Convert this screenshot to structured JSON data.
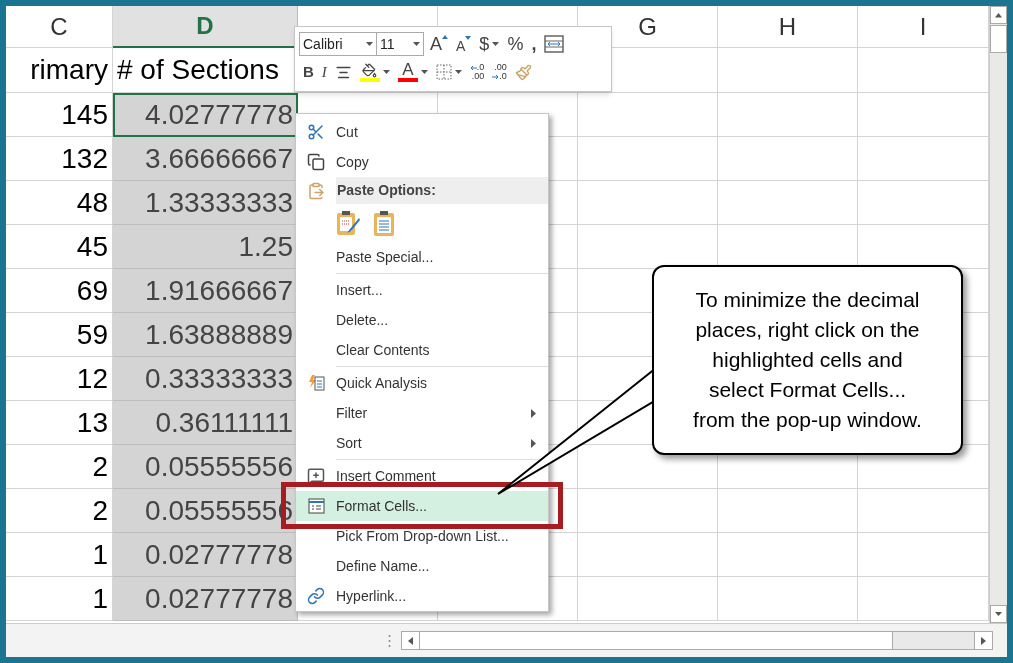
{
  "columns": [
    {
      "label": "C",
      "selected": false
    },
    {
      "label": "D",
      "selected": true
    },
    {
      "selected": false
    },
    {
      "selected": false
    },
    {
      "label": "G",
      "selected": false
    },
    {
      "label": "H",
      "selected": false
    },
    {
      "label": "I",
      "selected": false
    }
  ],
  "header_row": [
    "rimary",
    "# of Sections"
  ],
  "rows": [
    {
      "cells": [
        "145",
        "4.02777778"
      ],
      "active": true
    },
    {
      "cells": [
        "132",
        "3.66666667"
      ],
      "active": false
    },
    {
      "cells": [
        "48",
        "1.33333333"
      ],
      "active": false
    },
    {
      "cells": [
        "45",
        "1.25"
      ],
      "active": false
    },
    {
      "cells": [
        "69",
        "1.91666667"
      ],
      "active": false
    },
    {
      "cells": [
        "59",
        "1.63888889"
      ],
      "active": false
    },
    {
      "cells": [
        "12",
        "0.33333333"
      ],
      "active": false
    },
    {
      "cells": [
        "13",
        "0.36111111"
      ],
      "active": false
    },
    {
      "cells": [
        "2",
        "0.05555556"
      ],
      "active": false
    },
    {
      "cells": [
        "2",
        "0.05555556"
      ],
      "active": false
    },
    {
      "cells": [
        "1",
        "0.02777778"
      ],
      "active": false
    },
    {
      "cells": [
        "1",
        "0.02777778"
      ],
      "active": false
    }
  ],
  "mini_toolbar": {
    "font": "Calibri",
    "size": "11",
    "row1": [
      {
        "kind": "grow",
        "glyph": "A",
        "dropdown": false
      },
      {
        "kind": "shrink",
        "glyph": "A",
        "dropdown": false
      },
      {
        "kind": "currency",
        "glyph": "$",
        "dropdown": true
      },
      {
        "kind": "percent",
        "glyph": "%",
        "dropdown": false
      },
      {
        "kind": "comma",
        "glyph": ",",
        "dropdown": false
      },
      {
        "kind": "wrap",
        "dropdown": false
      }
    ],
    "row2": [
      {
        "kind": "bold",
        "glyph": "B",
        "dropdown": false
      },
      {
        "kind": "italic",
        "glyph": "I",
        "dropdown": false
      },
      {
        "kind": "center",
        "dropdown": false
      },
      {
        "kind": "fill",
        "color": "#ffff00",
        "dropdown": true
      },
      {
        "kind": "font-color",
        "glyph": "A",
        "color": "#ff0000",
        "dropdown": true
      },
      {
        "kind": "borders",
        "dropdown": true
      },
      {
        "kind": "increase-decimal",
        "glyph_top": ".0",
        "glyph_bottom": ".00",
        "dropdown": false
      },
      {
        "kind": "decrease-decimal",
        "glyph_top": ".00",
        "glyph_bottom": ".0",
        "dropdown": false
      },
      {
        "kind": "format-painter",
        "dropdown": false
      }
    ]
  },
  "context_menu": [
    {
      "kind": "cut",
      "label": "Cut",
      "selected": false,
      "submenu": false
    },
    {
      "kind": "copy",
      "label": "Copy",
      "selected": false,
      "submenu": false
    },
    {
      "kind": "header",
      "label": "Paste Options:"
    },
    {
      "kind": "paste-buttons"
    },
    {
      "kind": "plain",
      "label": "Paste Special...",
      "selected": false,
      "submenu": false
    },
    {
      "kind": "separator"
    },
    {
      "kind": "plain",
      "label": "Insert...",
      "selected": false,
      "submenu": false
    },
    {
      "kind": "plain",
      "label": "Delete...",
      "selected": false,
      "submenu": false
    },
    {
      "kind": "plain",
      "label": "Clear Contents",
      "selected": false,
      "submenu": false
    },
    {
      "kind": "separator"
    },
    {
      "kind": "quick-analysis",
      "label": "Quick Analysis",
      "selected": false,
      "submenu": false
    },
    {
      "kind": "plain",
      "label": "Filter",
      "selected": false,
      "submenu": true
    },
    {
      "kind": "plain",
      "label": "Sort",
      "selected": false,
      "submenu": true
    },
    {
      "kind": "separator"
    },
    {
      "kind": "comment",
      "label": "Insert Comment",
      "selected": false,
      "submenu": false
    },
    {
      "kind": "format-cells",
      "label": "Format Cells...",
      "selected": true,
      "submenu": false
    },
    {
      "kind": "plain",
      "label": "Pick From Drop-down List...",
      "selected": false,
      "submenu": false
    },
    {
      "kind": "plain",
      "label": "Define Name...",
      "selected": false,
      "submenu": false
    },
    {
      "kind": "hyperlink",
      "label": "Hyperlink...",
      "selected": false,
      "submenu": false
    }
  ],
  "callout": {
    "text": "To minimize the decimal places, right click on the highlighted cells and select Format Cells... from the pop-up window."
  }
}
